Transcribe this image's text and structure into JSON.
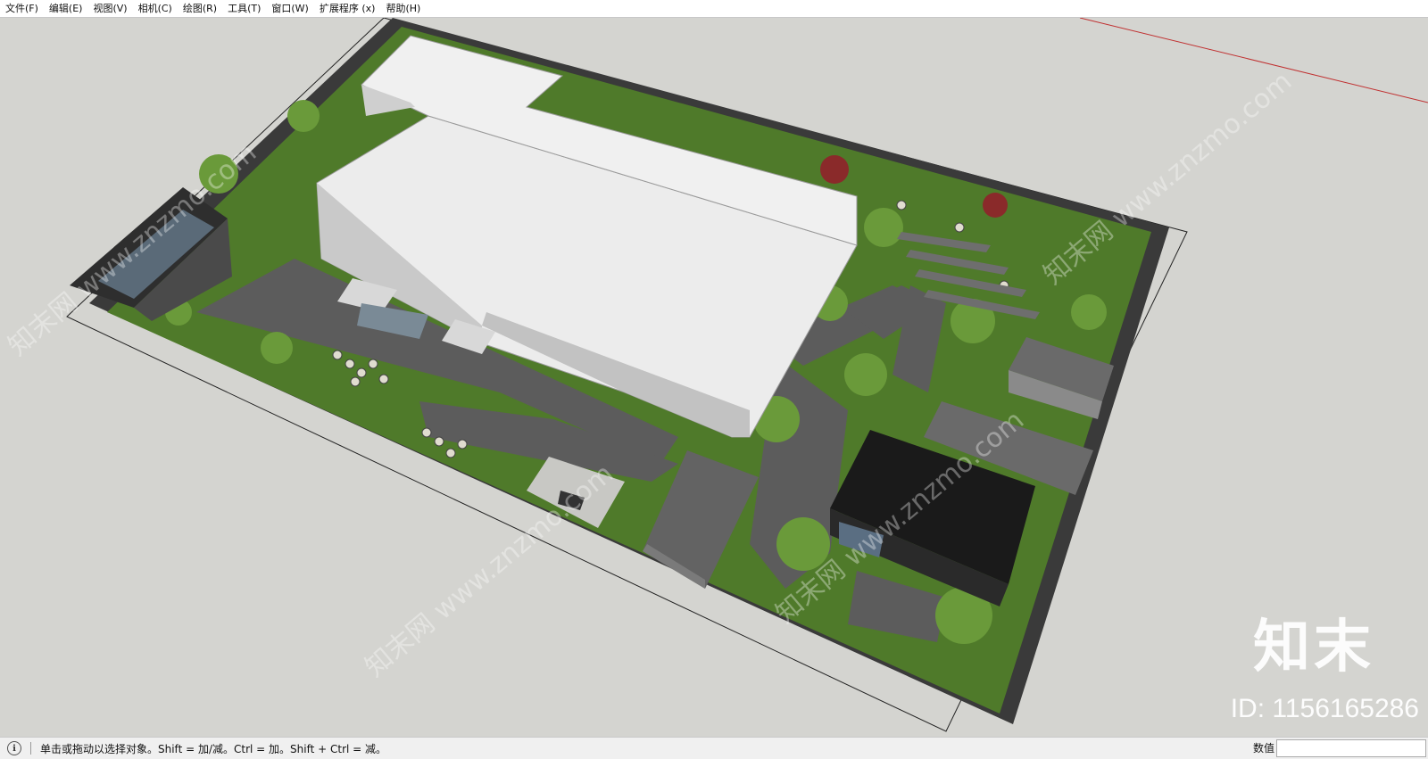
{
  "menubar": {
    "items": [
      "文件(F)",
      "编辑(E)",
      "视图(V)",
      "相机(C)",
      "绘图(R)",
      "工具(T)",
      "窗口(W)",
      "扩展程序 (x)",
      "帮助(H)"
    ]
  },
  "watermark": {
    "logo_text": "知末",
    "id_text": "ID: 1156165286"
  },
  "statusbar": {
    "hint_text": "单击或拖动以选择对象。Shift = 加/减。Ctrl = 加。Shift + Ctrl = 减。",
    "measure_label": "数值",
    "measure_value": "",
    "icons": [
      "help-icon"
    ]
  },
  "colors": {
    "background": "#d4d4d0",
    "lawn": "#5a8a2e",
    "paving": "#5c5c5c",
    "building": "#e8e8e8",
    "red_axis": "#c03030"
  }
}
